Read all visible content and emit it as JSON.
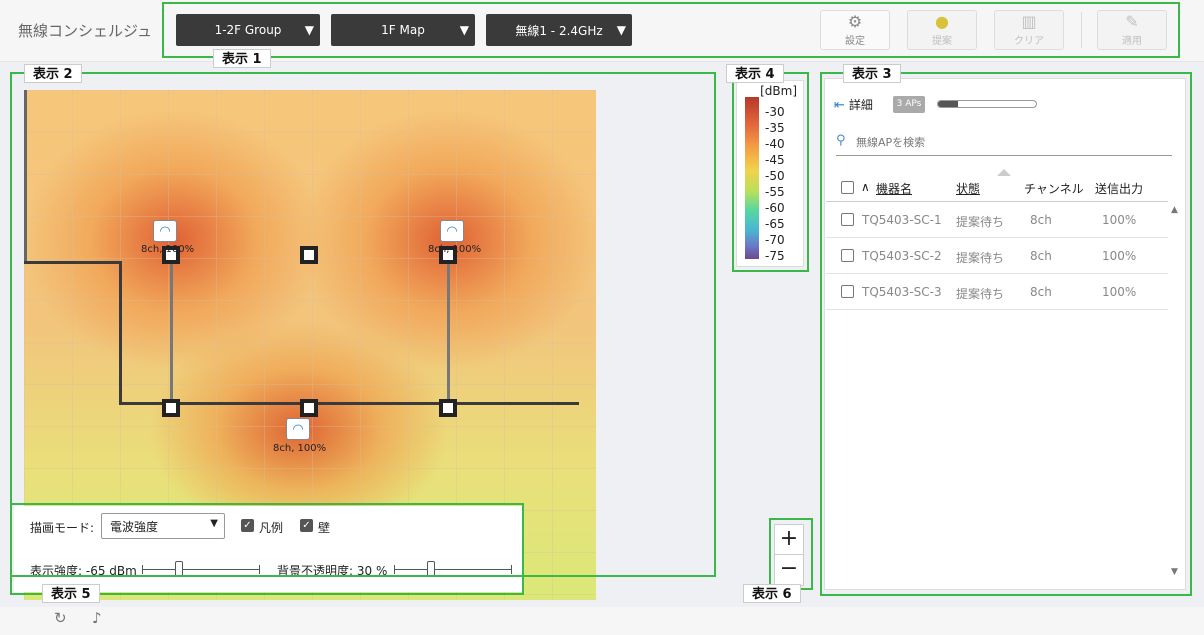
{
  "app": {
    "title": "無線コンシェルジュ"
  },
  "toolbar": {
    "group_select": "1-2F Group",
    "map_select": "1F Map",
    "band_select": "無線1 - 2.4GHz",
    "settings_label": "設定",
    "suggest_label": "提案",
    "clear_label": "クリア",
    "apply_label": "適用"
  },
  "callouts": [
    "表示 1",
    "表示 2",
    "表示 3",
    "表示 4",
    "表示 5",
    "表示 6"
  ],
  "map": {
    "aps": [
      {
        "label": "8ch, 100%"
      },
      {
        "label": "8ch, 100%"
      },
      {
        "label": "8ch, 100%"
      }
    ]
  },
  "legend": {
    "unit": "[dBm]",
    "ticks": [
      "-30",
      "-35",
      "-40",
      "-45",
      "-50",
      "-55",
      "-60",
      "-65",
      "-70",
      "-75"
    ]
  },
  "controls": {
    "mode_label": "描画モード:",
    "mode_value": "電波強度",
    "legend_chk_label": "凡例",
    "wall_chk_label": "壁",
    "strength_label": "表示強度: -65 dBm",
    "strength_fraction": 0.3,
    "opacity_label": "背景不透明度: 30 %",
    "opacity_fraction": 0.3
  },
  "zoom": {
    "plus": "+",
    "minus": "−"
  },
  "panel": {
    "detail_label": "詳細",
    "ap_count": "3 APs",
    "progress_fraction": 0.2,
    "search_placeholder": "無線APを検索",
    "columns": {
      "sort": "∧",
      "name": "機器名",
      "status": "状態",
      "channel": "チャンネル",
      "power": "送信出力"
    },
    "rows": [
      {
        "name": "TQ5403-SC-1",
        "status": "提案待ち",
        "channel": "8ch",
        "power": "100%"
      },
      {
        "name": "TQ5403-SC-2",
        "status": "提案待ち",
        "channel": "8ch",
        "power": "100%"
      },
      {
        "name": "TQ5403-SC-3",
        "status": "提案待ち",
        "channel": "8ch",
        "power": "100%"
      }
    ]
  },
  "colors": {
    "callout_border": "#3cb84a",
    "dropdown_bg": "#3a3a3a",
    "accent": "#2b7fd6"
  },
  "icons": [
    "gear-icon",
    "lightbulb-icon",
    "trash-icon",
    "wrench-icon",
    "wifi-icon",
    "search-icon",
    "refresh-icon",
    "bell-icon"
  ]
}
